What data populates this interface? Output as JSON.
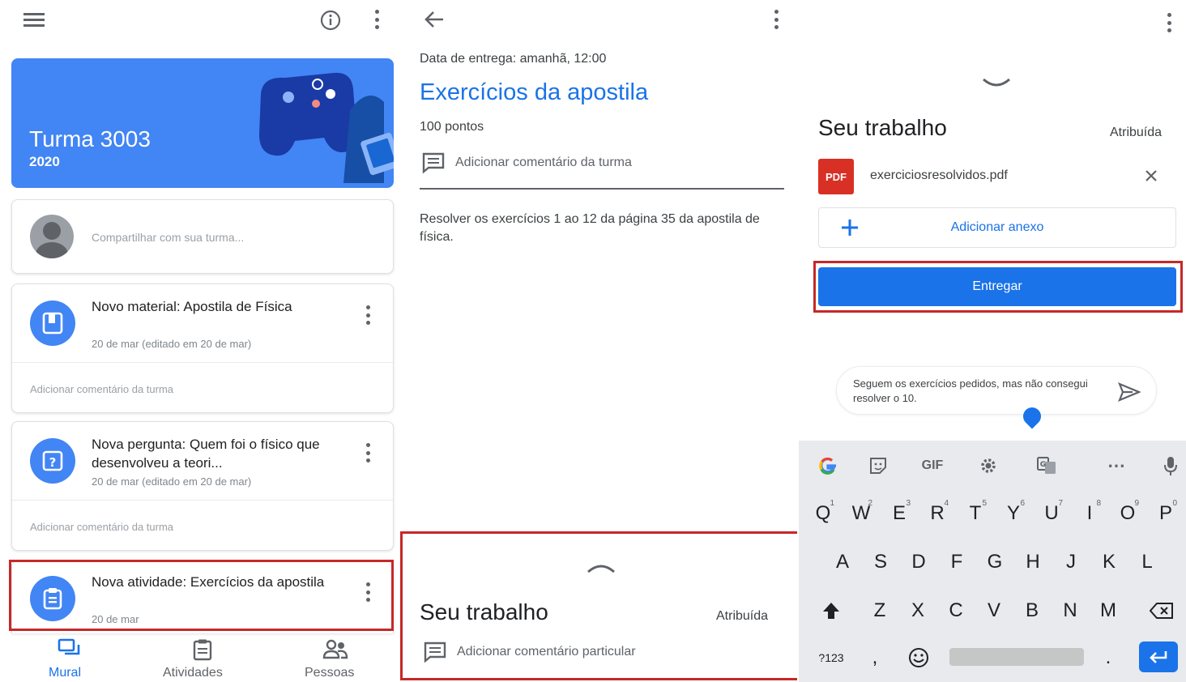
{
  "colors": {
    "accent": "#1a73e8",
    "banner": "#4285f4",
    "highlight": "#c62828",
    "pdf": "#d93025"
  },
  "class_stream": {
    "icons": {
      "menu": "menu-icon",
      "info": "info-icon",
      "more": "more-vert-icon"
    },
    "banner": {
      "title": "Turma 3003",
      "subtitle": "2020"
    },
    "share": {
      "placeholder": "Compartilhar com sua turma..."
    },
    "posts": [
      {
        "title": "Novo material: Apostila de Física",
        "date": "20 de mar (editado em 20 de mar)",
        "comment": "Adicionar comentário da turma"
      },
      {
        "title": "Nova pergunta: Quem foi o físico que desenvolveu a teori...",
        "date": "20 de mar (editado em 20 de mar)",
        "comment": "Adicionar comentário da turma"
      },
      {
        "title": "Nova atividade: Exercícios da apostila",
        "date": "20 de mar"
      }
    ],
    "bottom_nav": [
      {
        "label": "Mural",
        "active": true
      },
      {
        "label": "Atividades",
        "active": false
      },
      {
        "label": "Pessoas",
        "active": false
      }
    ]
  },
  "assignment": {
    "due": "Data de entrega: amanhã, 12:00",
    "title": "Exercícios da apostila",
    "points": "100 pontos",
    "class_comment": "Adicionar comentário da turma",
    "description": "Resolver os exercícios 1 ao 12 da página 35 da apostila de física.",
    "sheet": {
      "title": "Seu trabalho",
      "status": "Atribuída",
      "private_comment": "Adicionar comentário particular"
    }
  },
  "your_work": {
    "title": "Seu trabalho",
    "status": "Atribuída",
    "file": {
      "badge": "PDF",
      "name": "exerciciosresolvidos.pdf"
    },
    "add_attachment": "Adicionar anexo",
    "submit": "Entregar",
    "comment_text": "Seguem os exercícios pedidos, mas não consegui resolver o 10.",
    "keyboard": {
      "toolbar": [
        "G",
        "GIF",
        "⋯"
      ],
      "row1": [
        "Q",
        "W",
        "E",
        "R",
        "T",
        "Y",
        "U",
        "I",
        "O",
        "P"
      ],
      "row1_hints": [
        "1",
        "2",
        "3",
        "4",
        "5",
        "6",
        "7",
        "8",
        "9",
        "0"
      ],
      "row2": [
        "A",
        "S",
        "D",
        "F",
        "G",
        "H",
        "J",
        "K",
        "L"
      ],
      "row3": [
        "Z",
        "X",
        "C",
        "V",
        "B",
        "N",
        "M"
      ],
      "row4": {
        "symbols": "?123",
        "comma": ",",
        "period": "."
      }
    }
  }
}
